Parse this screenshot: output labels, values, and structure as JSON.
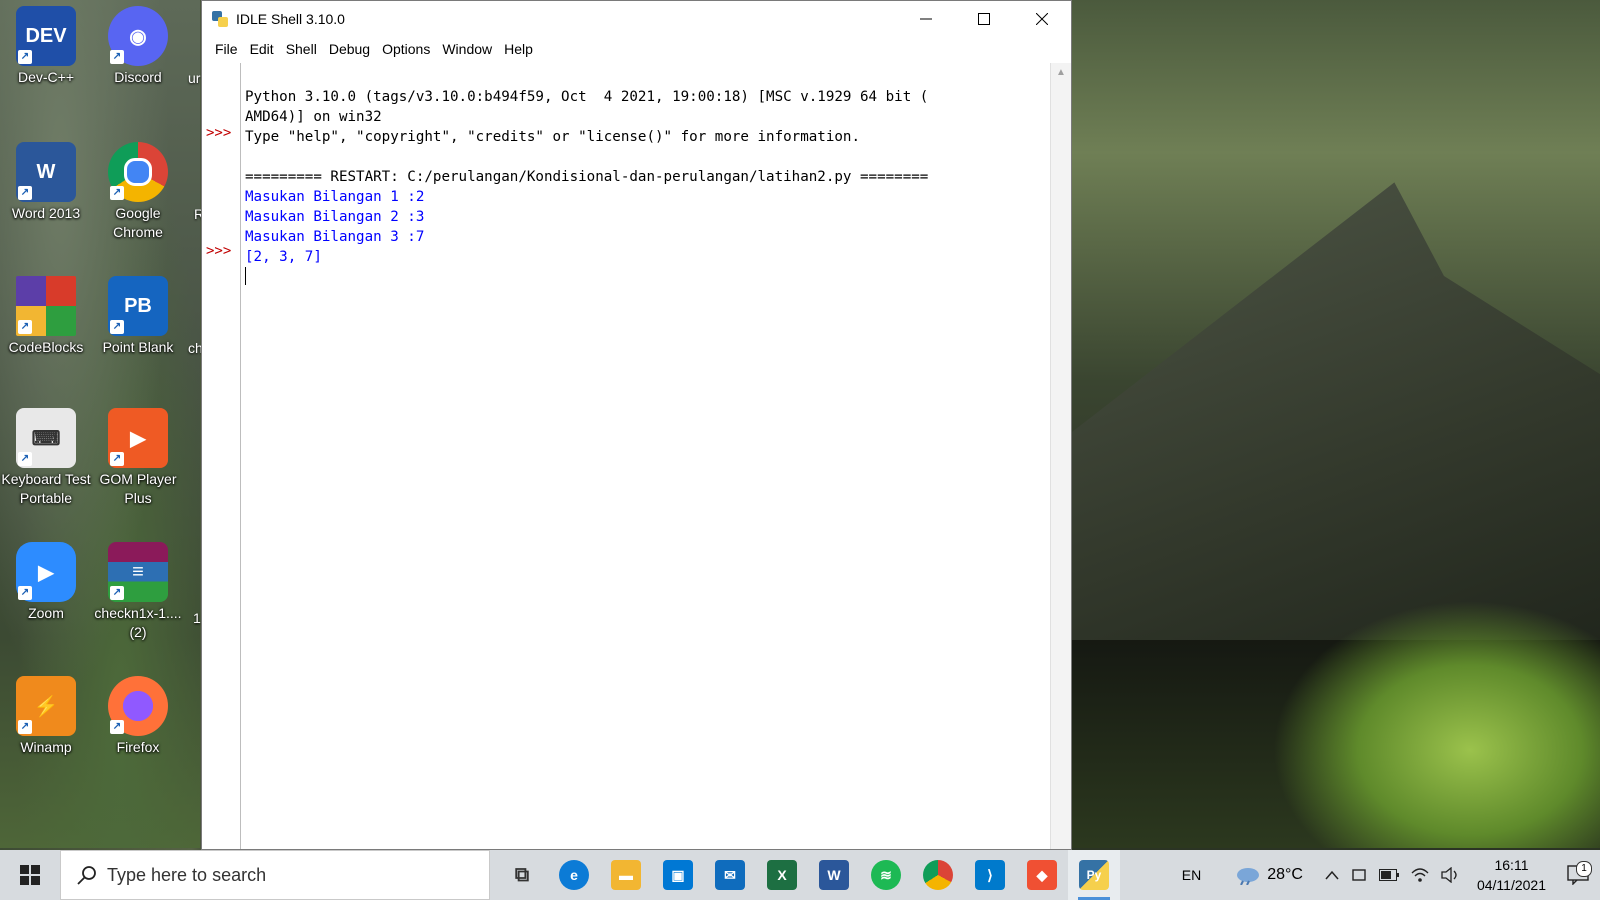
{
  "desktop": {
    "icons": [
      {
        "label": "Dev-C++",
        "glyph": "DEV",
        "color": "#1f4fa8"
      },
      {
        "label": "Discord",
        "glyph": "◉",
        "color": "#5865f2"
      },
      {
        "label": "Word 2013",
        "glyph": "W",
        "color": "#2b579a"
      },
      {
        "label": "Google Chrome",
        "glyph": "◎",
        "color": "#db4437"
      },
      {
        "label": "CodeBlocks",
        "glyph": "▦",
        "color": "#d83b2a"
      },
      {
        "label": "Point Blank",
        "glyph": "PB",
        "color": "#1565c0"
      },
      {
        "label": "Keyboard Test Portable",
        "glyph": "⌨",
        "color": "#e8e8e8"
      },
      {
        "label": "GOM Player Plus",
        "glyph": "▶",
        "color": "#ef5a24"
      },
      {
        "label": "Zoom",
        "glyph": "▶",
        "color": "#2d8cff"
      },
      {
        "label": "checkn1x-1.... (2)",
        "glyph": "≡",
        "color": "#8b1a5a"
      },
      {
        "label": "Winamp",
        "glyph": "⚡",
        "color": "#f08a1c"
      },
      {
        "label": "Firefox",
        "glyph": "◐",
        "color": "#ff7139"
      }
    ],
    "cut_labels": [
      "ur",
      "R",
      "ch",
      "1"
    ]
  },
  "window": {
    "title": "IDLE Shell 3.10.0",
    "menu": [
      "File",
      "Edit",
      "Shell",
      "Debug",
      "Options",
      "Window",
      "Help"
    ],
    "shell": {
      "prompt": ">>>",
      "lines": [
        {
          "text": "Python 3.10.0 (tags/v3.10.0:b494f59, Oct  4 2021, 19:00:18) [MSC v.1929 64 bit (",
          "color": "black"
        },
        {
          "text": "AMD64)] on win32",
          "color": "black"
        },
        {
          "text": "Type \"help\", \"copyright\", \"credits\" or \"license()\" for more information.",
          "color": "black"
        },
        {
          "text": "",
          "color": "black"
        },
        {
          "text": "========= RESTART: C:/perulangan/Kondisional-dan-perulangan/latihan2.py ========",
          "color": "black"
        },
        {
          "text": "Masukan Bilangan 1 :2",
          "color": "blue"
        },
        {
          "text": "Masukan Bilangan 2 :3",
          "color": "blue"
        },
        {
          "text": "Masukan Bilangan 3 :7",
          "color": "blue"
        },
        {
          "text": "[2, 3, 7]",
          "color": "blue"
        }
      ]
    }
  },
  "taskbar": {
    "search_placeholder": "Type here to search",
    "apps": [
      {
        "name": "task-view",
        "glyph": "⧉",
        "color": "#333333"
      },
      {
        "name": "edge",
        "glyph": "e",
        "color": "#0c7bd6"
      },
      {
        "name": "file-explorer",
        "glyph": "▬",
        "color": "#f2b632"
      },
      {
        "name": "microsoft-store",
        "glyph": "▣",
        "color": "#0078d4"
      },
      {
        "name": "mail",
        "glyph": "✉",
        "color": "#0f6cbd"
      },
      {
        "name": "excel",
        "glyph": "X",
        "color": "#1d6f42"
      },
      {
        "name": "word",
        "glyph": "W",
        "color": "#2b579a"
      },
      {
        "name": "spotify",
        "glyph": "≋",
        "color": "#1db954"
      },
      {
        "name": "chrome",
        "glyph": "◎",
        "color": "#db4437"
      },
      {
        "name": "vscode",
        "glyph": "⟩",
        "color": "#007acc"
      },
      {
        "name": "git",
        "glyph": "◆",
        "color": "#f05033"
      },
      {
        "name": "python-idle",
        "glyph": "Py",
        "color": "#3572a5"
      }
    ],
    "language": "EN",
    "temperature": "28°C",
    "time": "16:11",
    "date": "04/11/2021",
    "notification_count": "1"
  }
}
